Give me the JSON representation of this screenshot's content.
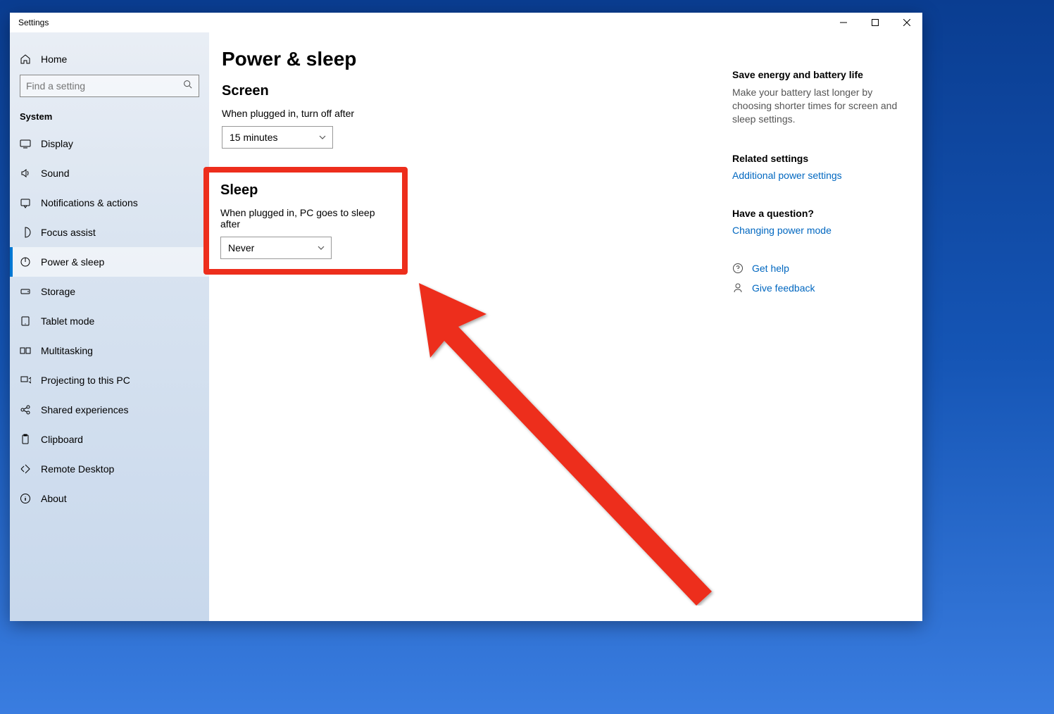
{
  "window": {
    "title": "Settings"
  },
  "sidebar": {
    "home": "Home",
    "search_placeholder": "Find a setting",
    "category": "System",
    "items": [
      {
        "label": "Display"
      },
      {
        "label": "Sound"
      },
      {
        "label": "Notifications & actions"
      },
      {
        "label": "Focus assist"
      },
      {
        "label": "Power & sleep"
      },
      {
        "label": "Storage"
      },
      {
        "label": "Tablet mode"
      },
      {
        "label": "Multitasking"
      },
      {
        "label": "Projecting to this PC"
      },
      {
        "label": "Shared experiences"
      },
      {
        "label": "Clipboard"
      },
      {
        "label": "Remote Desktop"
      },
      {
        "label": "About"
      }
    ]
  },
  "main": {
    "title": "Power & sleep",
    "screen": {
      "heading": "Screen",
      "label": "When plugged in, turn off after",
      "value": "15 minutes"
    },
    "sleep": {
      "heading": "Sleep",
      "label": "When plugged in, PC goes to sleep after",
      "value": "Never"
    }
  },
  "aside": {
    "energy_heading": "Save energy and battery life",
    "energy_text": "Make your battery last longer by choosing shorter times for screen and sleep settings.",
    "related_heading": "Related settings",
    "related_link": "Additional power settings",
    "question_heading": "Have a question?",
    "question_link": "Changing power mode",
    "help": "Get help",
    "feedback": "Give feedback"
  },
  "annotation": {
    "color": "#ed2e1c"
  }
}
